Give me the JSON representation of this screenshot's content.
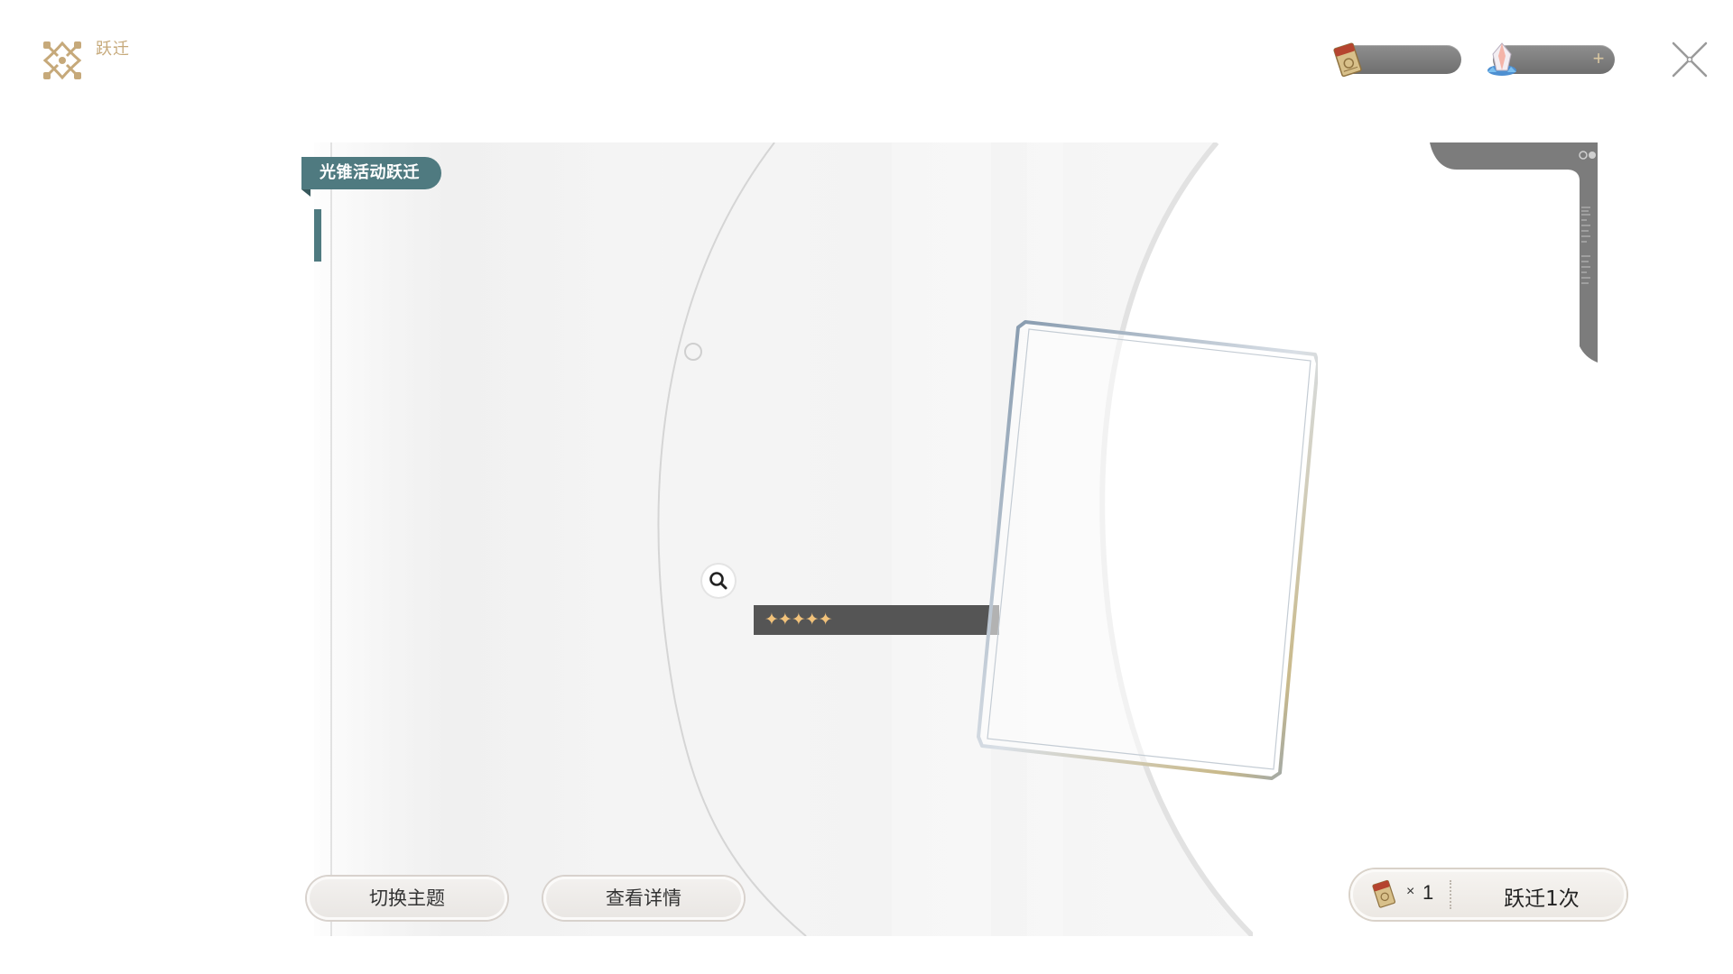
{
  "header": {
    "title": "跃迁"
  },
  "currencies": {
    "pass": {
      "icon": "star-rail-special-pass-icon",
      "value": ""
    },
    "jade": {
      "icon": "stellar-jade-icon",
      "value": "",
      "add_label": "+"
    }
  },
  "banner": {
    "tag": "光锥活动跃迁",
    "rarity_stars": "✦✦✦✦✦",
    "rarity": 5
  },
  "buttons": {
    "switch_theme": "切换主题",
    "view_details": "查看详情"
  },
  "warp": {
    "cost_icon": "star-rail-special-pass-icon",
    "cost_prefix": "×",
    "cost": "1",
    "label": "跃迁1次"
  },
  "colors": {
    "accent_teal": "#4f7a80",
    "gold": "#c6a97a",
    "rarity_gold": "#f2c27a",
    "currency_pill": "#7d7d7d"
  }
}
